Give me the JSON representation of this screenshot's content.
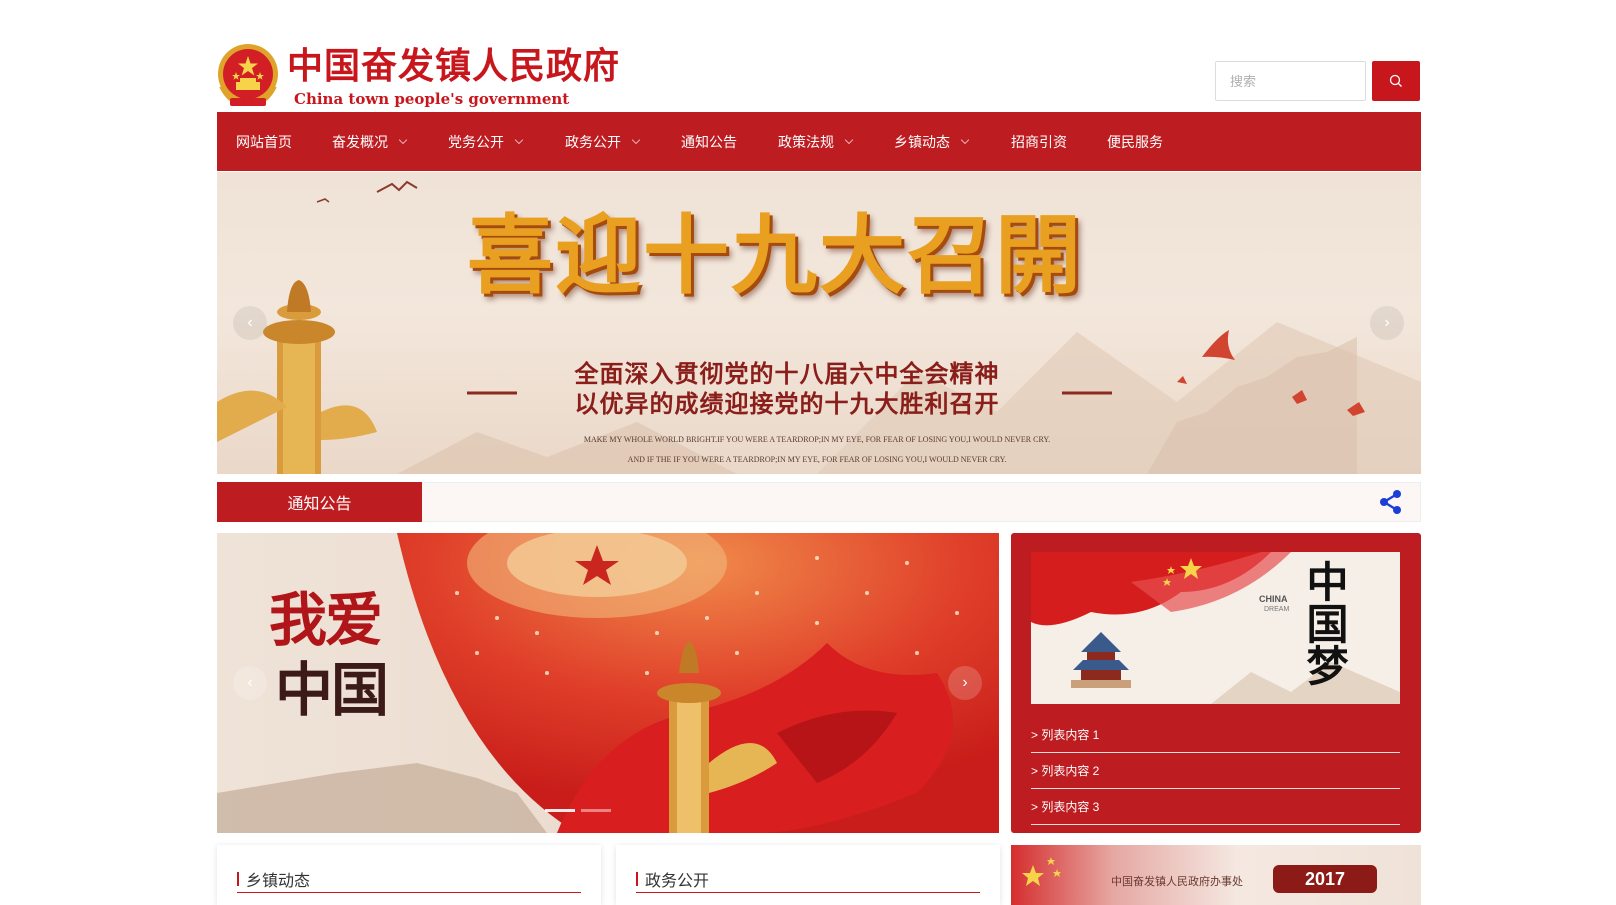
{
  "header": {
    "site_title": "中国奋发镇人民政府",
    "site_subtitle": "China town people's government",
    "search_placeholder": "搜索"
  },
  "nav": {
    "items": [
      {
        "label": "网站首页",
        "dropdown": false
      },
      {
        "label": "奋发概况",
        "dropdown": true
      },
      {
        "label": "党务公开",
        "dropdown": true
      },
      {
        "label": "政务公开",
        "dropdown": true
      },
      {
        "label": "通知公告",
        "dropdown": false
      },
      {
        "label": "政策法规",
        "dropdown": true
      },
      {
        "label": "乡镇动态",
        "dropdown": true
      },
      {
        "label": "招商引资",
        "dropdown": false
      },
      {
        "label": "便民服务",
        "dropdown": false
      }
    ]
  },
  "banner": {
    "headline": "喜迎十九大召開",
    "line1": "全面深入贯彻党的十八届六中全会精神",
    "line2": "以优异的成绩迎接党的十九大胜利召开",
    "en1": "MAKE MY WHOLE WORLD BRIGHT.IF YOU WERE A TEARDROP;IN MY EYE, FOR FEAR OF LOSING YOU,I WOULD NEVER CRY.",
    "en2": "AND IF THE IF YOU WERE A TEARDROP;IN MY EYE, FOR FEAR OF LOSING YOU,I WOULD NEVER CRY."
  },
  "notice": {
    "label": "通知公告"
  },
  "main_slide": {
    "calligraphy_1": "我爱",
    "calligraphy_2": "中国"
  },
  "side_panel": {
    "image_text_zh": "中国梦",
    "image_text_en_1": "CHINA",
    "image_text_en_2": "DREAM",
    "items": [
      "> 列表内容 1",
      "> 列表内容 2",
      "> 列表内容 3"
    ]
  },
  "cards": [
    {
      "title": "乡镇动态"
    },
    {
      "title": "政务公开"
    }
  ],
  "bottom_banner": {
    "text": "中国奋发镇人民政府办事处",
    "year": "2017"
  },
  "colors": {
    "brand_red": "#bd1c21",
    "title_red": "#c8161d",
    "share_icon_blue": "#1a3fd6"
  }
}
